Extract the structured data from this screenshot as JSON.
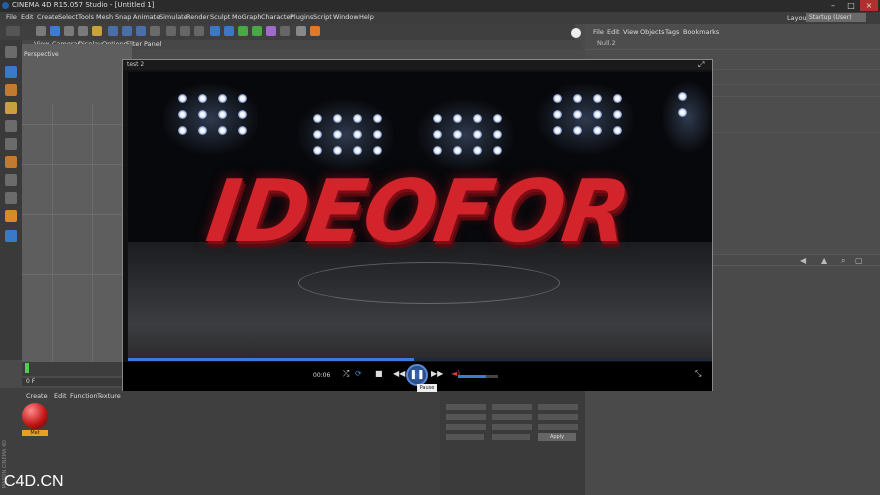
{
  "app": {
    "title": "CINEMA 4D R15.057 Studio - [Untitled 1]"
  },
  "menu": [
    "File",
    "Edit",
    "Create",
    "Select",
    "Tools",
    "Mesh",
    "Snap",
    "Animate",
    "Simulate",
    "Render",
    "Sculpt",
    "MoGraph",
    "Character",
    "Plugins",
    "Script",
    "Window",
    "Help"
  ],
  "layout": {
    "label": "Layout:",
    "value": "Startup (User)"
  },
  "viewport_menu": [
    "View",
    "Cameras",
    "Display",
    "Options",
    "Filter",
    "Panel"
  ],
  "viewport_label": "Perspective",
  "object_manager": {
    "menu": [
      "File",
      "Edit",
      "View",
      "Objects",
      "Tags",
      "Bookmarks"
    ],
    "item": "Null.2"
  },
  "player": {
    "title": "test 2",
    "time": "00:06",
    "tooltip": "Pause",
    "progress": 0.49,
    "volume": 0.7,
    "overlay_text": "IDEOFOR"
  },
  "timeline": {
    "frame": "0 F"
  },
  "material_manager": {
    "menu": [
      "Create",
      "Edit",
      "Function",
      "Texture"
    ],
    "material_label": "Mat"
  },
  "coord_manager": {
    "apply_label": "Apply"
  },
  "watermark": "C4D.CN",
  "side_brand": "MAXON CINEMA 4D",
  "colors": {
    "accent": "#3c7ad8",
    "text_red": "#d3242c"
  }
}
